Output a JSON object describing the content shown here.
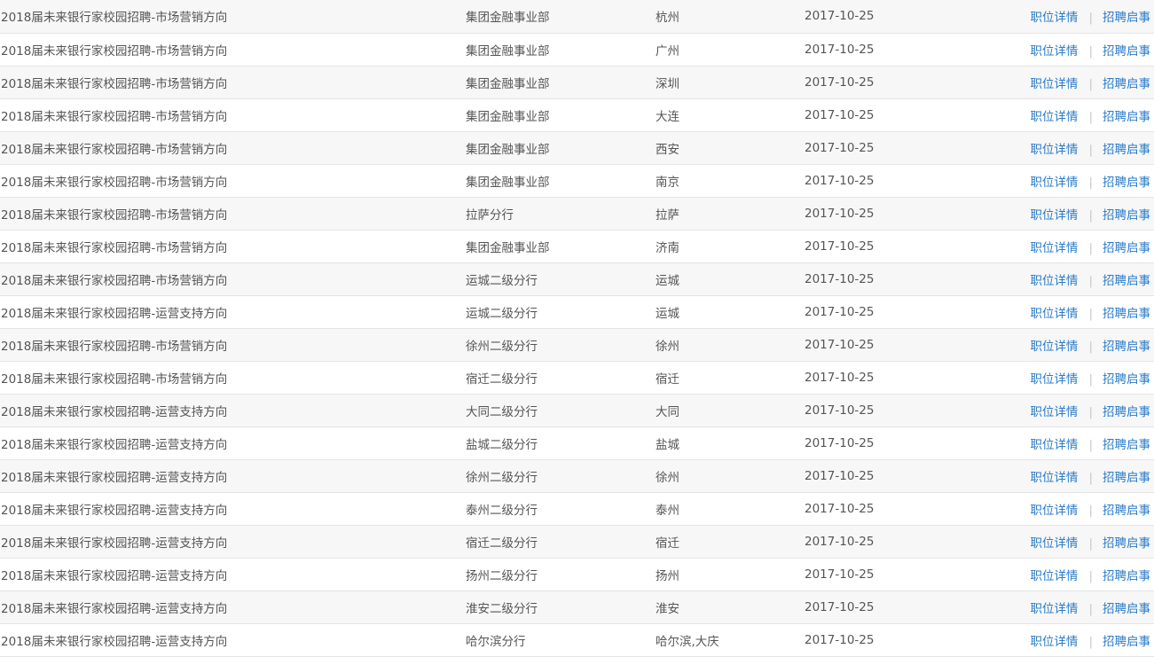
{
  "actions": {
    "detail_label": "职位详情",
    "separator": "|",
    "notice_label": "招聘启事"
  },
  "rows": [
    {
      "title": "2018届未来银行家校园招聘-市场营销方向",
      "dept": "集团金融事业部",
      "city": "杭州",
      "date": "2017-10-25"
    },
    {
      "title": "2018届未来银行家校园招聘-市场营销方向",
      "dept": "集团金融事业部",
      "city": "广州",
      "date": "2017-10-25"
    },
    {
      "title": "2018届未来银行家校园招聘-市场营销方向",
      "dept": "集团金融事业部",
      "city": "深圳",
      "date": "2017-10-25"
    },
    {
      "title": "2018届未来银行家校园招聘-市场营销方向",
      "dept": "集团金融事业部",
      "city": "大连",
      "date": "2017-10-25"
    },
    {
      "title": "2018届未来银行家校园招聘-市场营销方向",
      "dept": "集团金融事业部",
      "city": "西安",
      "date": "2017-10-25"
    },
    {
      "title": "2018届未来银行家校园招聘-市场营销方向",
      "dept": "集团金融事业部",
      "city": "南京",
      "date": "2017-10-25"
    },
    {
      "title": "2018届未来银行家校园招聘-市场营销方向",
      "dept": "拉萨分行",
      "city": "拉萨",
      "date": "2017-10-25"
    },
    {
      "title": "2018届未来银行家校园招聘-市场营销方向",
      "dept": "集团金融事业部",
      "city": "济南",
      "date": "2017-10-25"
    },
    {
      "title": "2018届未来银行家校园招聘-市场营销方向",
      "dept": "运城二级分行",
      "city": "运城",
      "date": "2017-10-25"
    },
    {
      "title": "2018届未来银行家校园招聘-运营支持方向",
      "dept": "运城二级分行",
      "city": "运城",
      "date": "2017-10-25"
    },
    {
      "title": "2018届未来银行家校园招聘-市场营销方向",
      "dept": "徐州二级分行",
      "city": "徐州",
      "date": "2017-10-25"
    },
    {
      "title": "2018届未来银行家校园招聘-市场营销方向",
      "dept": "宿迁二级分行",
      "city": "宿迁",
      "date": "2017-10-25"
    },
    {
      "title": "2018届未来银行家校园招聘-运营支持方向",
      "dept": "大同二级分行",
      "city": "大同",
      "date": "2017-10-25"
    },
    {
      "title": "2018届未来银行家校园招聘-运营支持方向",
      "dept": "盐城二级分行",
      "city": "盐城",
      "date": "2017-10-25"
    },
    {
      "title": "2018届未来银行家校园招聘-运营支持方向",
      "dept": "徐州二级分行",
      "city": "徐州",
      "date": "2017-10-25"
    },
    {
      "title": "2018届未来银行家校园招聘-运营支持方向",
      "dept": "泰州二级分行",
      "city": "泰州",
      "date": "2017-10-25"
    },
    {
      "title": "2018届未来银行家校园招聘-运营支持方向",
      "dept": "宿迁二级分行",
      "city": "宿迁",
      "date": "2017-10-25"
    },
    {
      "title": "2018届未来银行家校园招聘-运营支持方向",
      "dept": "扬州二级分行",
      "city": "扬州",
      "date": "2017-10-25"
    },
    {
      "title": "2018届未来银行家校园招聘-运营支持方向",
      "dept": "淮安二级分行",
      "city": "淮安",
      "date": "2017-10-25"
    },
    {
      "title": "2018届未来银行家校园招聘-运营支持方向",
      "dept": "哈尔滨分行",
      "city": "哈尔滨,大庆",
      "date": "2017-10-25"
    }
  ]
}
